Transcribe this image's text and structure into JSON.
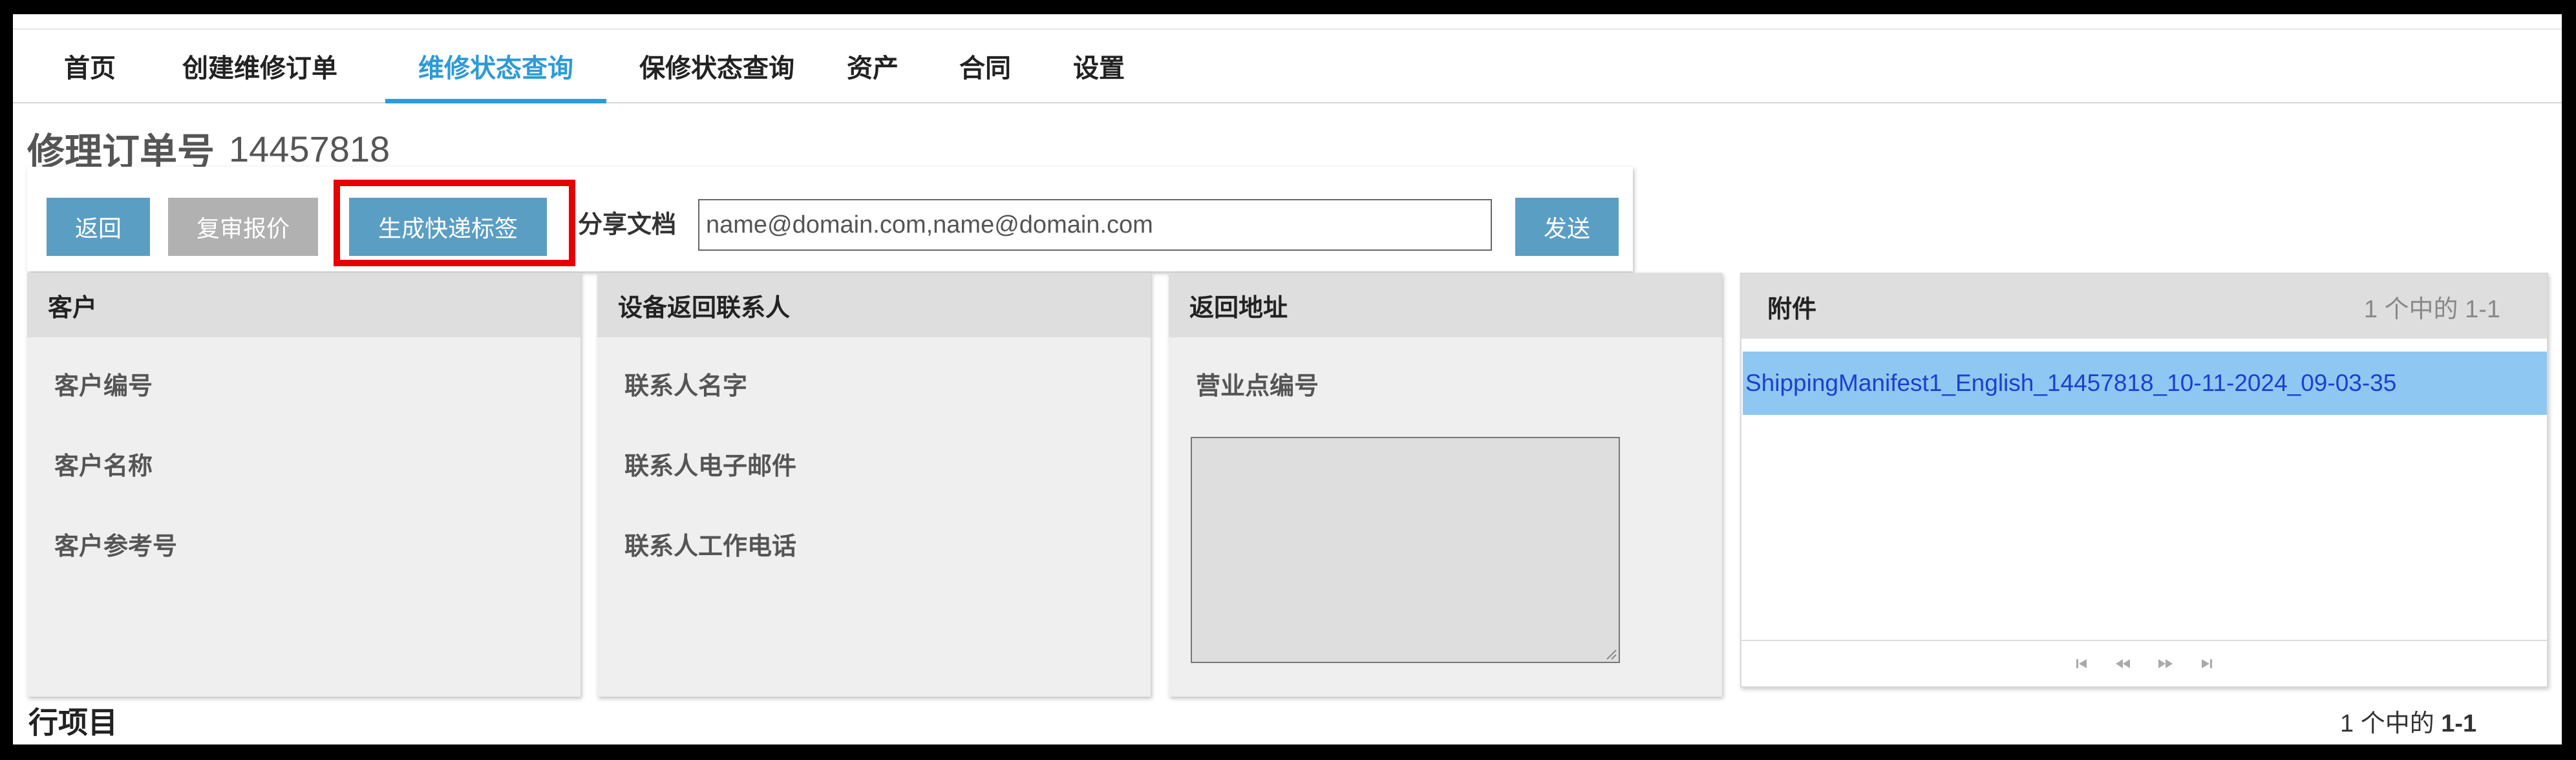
{
  "nav": {
    "items": [
      {
        "label": "首页",
        "active": false
      },
      {
        "label": "创建维修订单",
        "active": false
      },
      {
        "label": "维修状态查询",
        "active": true
      },
      {
        "label": "保修状态查询",
        "active": false
      },
      {
        "label": "资产",
        "active": false
      },
      {
        "label": "合同",
        "active": false
      },
      {
        "label": "设置",
        "active": false
      }
    ]
  },
  "page": {
    "title_label": "修理订单号",
    "order_number": "14457818"
  },
  "actions": {
    "back_label": "返回",
    "review_quote_label": "复审报价",
    "generate_label_label": "生成快递标签",
    "share_label": "分享文档",
    "share_placeholder": "name@domain.com,name@domain.com",
    "send_label": "发送"
  },
  "customer": {
    "header": "客户",
    "fields": [
      "客户编号",
      "客户名称",
      "客户参考号"
    ]
  },
  "contact": {
    "header": "设备返回联系人",
    "fields": [
      "联系人名字",
      "联系人电子邮件",
      "联系人工作电话"
    ]
  },
  "return_address": {
    "header": "返回地址",
    "fields": [
      "营业点编号"
    ]
  },
  "attachments": {
    "header": "附件",
    "count": "1 个中的 1-1",
    "items": [
      "ShippingManifest1_English_14457818_10-11-2024_09-03-35"
    ]
  },
  "line_items": {
    "header": "行项目",
    "count_prefix": "1 个中的 ",
    "count_range": "1-1"
  },
  "colors": {
    "accent": "#2e9ad8",
    "button_primary": "#5b9ec4",
    "button_disabled": "#b1b1b1",
    "highlight": "#e60000",
    "selected_row": "#8ec8f2",
    "link": "#1d3fd0"
  }
}
